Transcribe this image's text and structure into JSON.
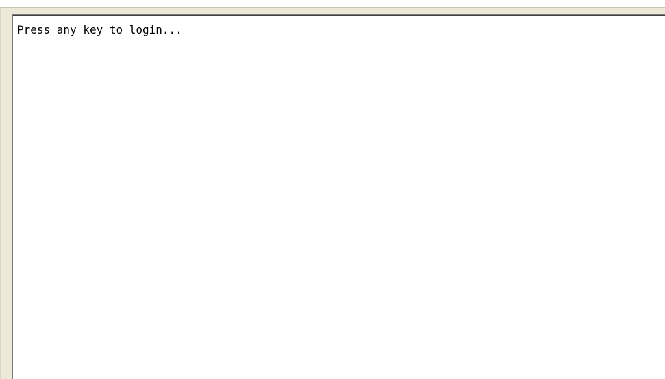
{
  "terminal": {
    "lines": [
      "Press any key to login..."
    ]
  }
}
